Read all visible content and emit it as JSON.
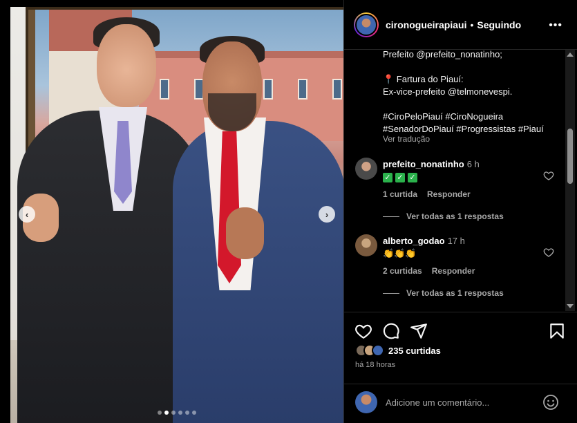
{
  "header": {
    "username": "cironogueirapiaui",
    "separator": "•",
    "follow_status": "Seguindo",
    "more_glyph": "•••"
  },
  "post": {
    "carousel": {
      "total_slides": 6,
      "active_slide": 2
    },
    "prev_glyph": "‹",
    "next_glyph": "›"
  },
  "caption": {
    "lines": [
      "Prefeito @prefeito_nonatinho;",
      "",
      "📍 Fartura do Piauí:",
      "Ex-vice-prefeito @telmonevespi.",
      "",
      "#CiroPeloPiauí #CiroNogueira",
      "#SenadorDoPiauí #Progressistas #Piauí"
    ],
    "translate": "Ver tradução"
  },
  "comments": [
    {
      "username": "prefeito_nonatinho",
      "time": "6 h",
      "body": "",
      "check_count": 3,
      "likes": "1 curtida",
      "reply": "Responder",
      "view_replies": "Ver todas as 1 respostas",
      "avatar_color": "#4a4a4a"
    },
    {
      "username": "alberto_godao",
      "time": "17 h",
      "body": "👏👏👏",
      "check_count": 0,
      "likes": "2 curtidas",
      "reply": "Responder",
      "view_replies": "Ver todas as 1 respostas",
      "avatar_color": "#c9a57f"
    }
  ],
  "actions": {
    "likes_count": "235 curtidas",
    "time_ago": "há 18 horas"
  },
  "comment_box": {
    "placeholder": "Adicione um comentário..."
  },
  "icons": [
    "heart-icon",
    "comment-icon",
    "share-icon",
    "bookmark-icon",
    "emoji-icon",
    "more-icon"
  ],
  "colors": {
    "background": "#000000",
    "text": "#f5f5f5",
    "muted": "#a8a8a8",
    "check": "#2bb24c"
  }
}
